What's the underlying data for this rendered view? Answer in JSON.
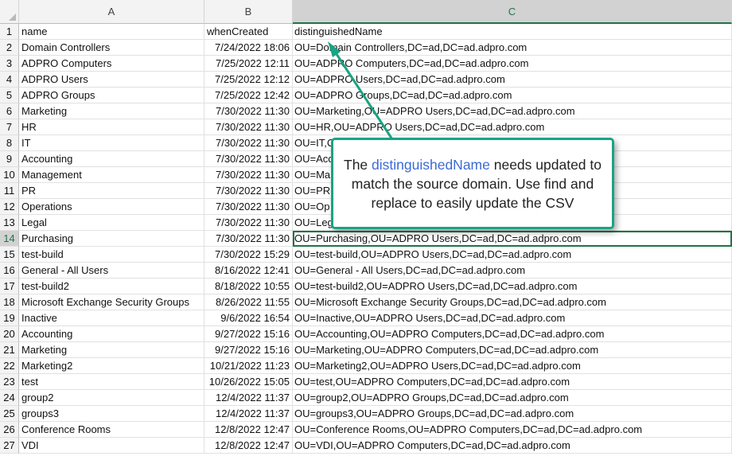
{
  "columns": [
    "A",
    "B",
    "C"
  ],
  "headers": {
    "name": "name",
    "created": "whenCreated",
    "dn": "distinguishedName"
  },
  "rows": [
    {
      "num": "2",
      "name": "Domain Controllers",
      "created": "7/24/2022 18:06",
      "dn": "OU=Domain Controllers,DC=ad,DC=ad.adpro.com"
    },
    {
      "num": "3",
      "name": "ADPRO Computers",
      "created": "7/25/2022 12:11",
      "dn": "OU=ADPRO Computers,DC=ad,DC=ad.adpro.com"
    },
    {
      "num": "4",
      "name": "ADPRO Users",
      "created": "7/25/2022 12:12",
      "dn": "OU=ADPRO Users,DC=ad,DC=ad.adpro.com"
    },
    {
      "num": "5",
      "name": "ADPRO Groups",
      "created": "7/25/2022 12:42",
      "dn": "OU=ADPRO Groups,DC=ad,DC=ad.adpro.com"
    },
    {
      "num": "6",
      "name": "Marketing",
      "created": "7/30/2022 11:30",
      "dn": "OU=Marketing,OU=ADPRO Users,DC=ad,DC=ad.adpro.com"
    },
    {
      "num": "7",
      "name": "HR",
      "created": "7/30/2022 11:30",
      "dn": "OU=HR,OU=ADPRO Users,DC=ad,DC=ad.adpro.com"
    },
    {
      "num": "8",
      "name": "IT",
      "created": "7/30/2022 11:30",
      "dn": "OU=IT,C"
    },
    {
      "num": "9",
      "name": "Accounting",
      "created": "7/30/2022 11:30",
      "dn": "OU=Acc"
    },
    {
      "num": "10",
      "name": "Management",
      "created": "7/30/2022 11:30",
      "dn": "OU=Ma"
    },
    {
      "num": "11",
      "name": "PR",
      "created": "7/30/2022 11:30",
      "dn": "OU=PR,"
    },
    {
      "num": "12",
      "name": "Operations",
      "created": "7/30/2022 11:30",
      "dn": "OU=Op"
    },
    {
      "num": "13",
      "name": "Legal",
      "created": "7/30/2022 11:30",
      "dn": "OU=Leg"
    },
    {
      "num": "14",
      "name": "Purchasing",
      "created": "7/30/2022 11:30",
      "dn": "OU=Purchasing,OU=ADPRO Users,DC=ad,DC=ad.adpro.com"
    },
    {
      "num": "15",
      "name": "test-build",
      "created": "7/30/2022 15:29",
      "dn": "OU=test-build,OU=ADPRO Users,DC=ad,DC=ad.adpro.com"
    },
    {
      "num": "16",
      "name": "General - All Users",
      "created": "8/16/2022 12:41",
      "dn": "OU=General - All Users,DC=ad,DC=ad.adpro.com"
    },
    {
      "num": "17",
      "name": "test-build2",
      "created": "8/18/2022 10:55",
      "dn": "OU=test-build2,OU=ADPRO Users,DC=ad,DC=ad.adpro.com"
    },
    {
      "num": "18",
      "name": "Microsoft Exchange Security Groups",
      "created": "8/26/2022 11:55",
      "dn": "OU=Microsoft Exchange Security Groups,DC=ad,DC=ad.adpro.com"
    },
    {
      "num": "19",
      "name": "Inactive",
      "created": "9/6/2022 16:54",
      "dn": "OU=Inactive,OU=ADPRO Users,DC=ad,DC=ad.adpro.com"
    },
    {
      "num": "20",
      "name": "Accounting",
      "created": "9/27/2022 15:16",
      "dn": "OU=Accounting,OU=ADPRO Computers,DC=ad,DC=ad.adpro.com"
    },
    {
      "num": "21",
      "name": "Marketing",
      "created": "9/27/2022 15:16",
      "dn": "OU=Marketing,OU=ADPRO Computers,DC=ad,DC=ad.adpro.com"
    },
    {
      "num": "22",
      "name": "Marketing2",
      "created": "10/21/2022 11:23",
      "dn": "OU=Marketing2,OU=ADPRO Users,DC=ad,DC=ad.adpro.com"
    },
    {
      "num": "23",
      "name": "test",
      "created": "10/26/2022 15:05",
      "dn": "OU=test,OU=ADPRO Computers,DC=ad,DC=ad.adpro.com"
    },
    {
      "num": "24",
      "name": "group2",
      "created": "12/4/2022 11:37",
      "dn": "OU=group2,OU=ADPRO Groups,DC=ad,DC=ad.adpro.com"
    },
    {
      "num": "25",
      "name": "groups3",
      "created": "12/4/2022 11:37",
      "dn": "OU=groups3,OU=ADPRO Groups,DC=ad,DC=ad.adpro.com"
    },
    {
      "num": "26",
      "name": "Conference Rooms",
      "created": "12/8/2022 12:47",
      "dn": "OU=Conference Rooms,OU=ADPRO Computers,DC=ad,DC=ad.adpro.com"
    },
    {
      "num": "27",
      "name": "VDI",
      "created": "12/8/2022 12:47",
      "dn": "OU=VDI,OU=ADPRO Computers,DC=ad,DC=ad.adpro.com"
    }
  ],
  "callout": {
    "prefix": "The ",
    "highlight": "distinguishedName",
    "suffix": " needs updated to match the source domain. Use find and replace to easily update the CSV"
  },
  "colors": {
    "selection": "#217346",
    "callout_border": "#1aa384",
    "highlight": "#3c6bd4"
  }
}
